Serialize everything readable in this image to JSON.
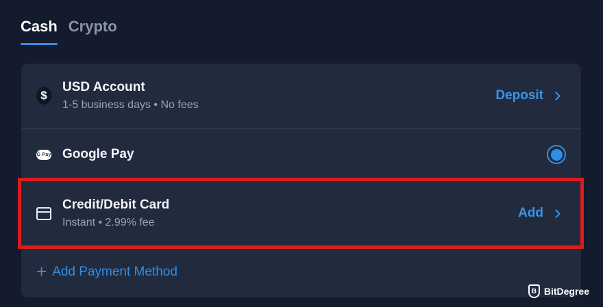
{
  "tabs": [
    {
      "label": "Cash",
      "active": true
    },
    {
      "label": "Crypto",
      "active": false
    }
  ],
  "methods": {
    "usd": {
      "icon_glyph": "$",
      "icon": "dollar-icon",
      "title": "USD Account",
      "subtitle": "1-5 business days • No fees",
      "action_label": "Deposit"
    },
    "gpay": {
      "icon_text": "G Pay",
      "icon": "google-pay-icon",
      "title": "Google Pay",
      "selected": true
    },
    "card": {
      "icon": "credit-card-icon",
      "title": "Credit/Debit Card",
      "subtitle": "Instant • 2.99% fee",
      "action_label": "Add"
    }
  },
  "add_method": {
    "plus": "+",
    "label": "Add Payment Method"
  },
  "watermark": {
    "logo_letter": "B",
    "text": "BitDegree"
  },
  "colors": {
    "background": "#141b2d",
    "panel": "#222b3e",
    "accent": "#2f8ee8",
    "highlight": "#d91c1c"
  }
}
